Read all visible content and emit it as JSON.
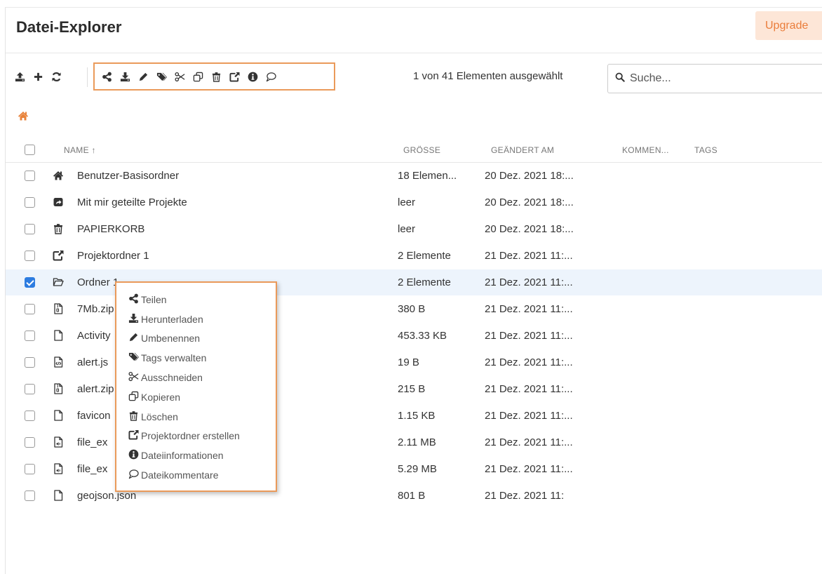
{
  "header": {
    "title": "Datei-Explorer",
    "upgrade_label": "Upgrade"
  },
  "toolbar": {
    "left": [
      {
        "name": "upload-icon"
      },
      {
        "name": "add-icon"
      },
      {
        "name": "refresh-icon"
      }
    ],
    "selection": [
      {
        "name": "share-icon"
      },
      {
        "name": "download-icon"
      },
      {
        "name": "pencil-icon"
      },
      {
        "name": "tags-icon"
      },
      {
        "name": "scissors-icon"
      },
      {
        "name": "copy-icon"
      },
      {
        "name": "trash-icon"
      },
      {
        "name": "share-square-icon"
      },
      {
        "name": "info-icon"
      },
      {
        "name": "comment-icon"
      }
    ],
    "selection_count": "1 von 41 Elementen ausgewählt",
    "search_placeholder": "Suche..."
  },
  "breadcrumb": {
    "icon": "home-icon"
  },
  "table": {
    "columns": {
      "name": "NAME ↑",
      "size": "GRÖSSE",
      "modified": "GEÄNDERT AM",
      "comments": "KOMMEN...",
      "tags": "TAGS"
    },
    "rows": [
      {
        "icon": "home-icon",
        "name": "Benutzer-Basisordner",
        "size": "18 Elemen...",
        "modified": "20 Dez. 2021 18:...",
        "checked": false
      },
      {
        "icon": "shared-folder-icon",
        "name": "Mit mir geteilte Projekte",
        "size": "leer",
        "modified": "20 Dez. 2021 18:...",
        "checked": false
      },
      {
        "icon": "trash-icon",
        "name": "PAPIERKORB",
        "size": "leer",
        "modified": "20 Dez. 2021 18:...",
        "checked": false
      },
      {
        "icon": "share-square-icon",
        "name": "Projektordner 1",
        "size": "2 Elemente",
        "modified": "21 Dez. 2021 11:...",
        "checked": false
      },
      {
        "icon": "folder-open-icon",
        "name": "Ordner 1",
        "size": "2 Elemente",
        "modified": "21 Dez. 2021 11:...",
        "checked": true
      },
      {
        "icon": "zip-file-icon",
        "name": "7Mb.zip",
        "size": "380 B",
        "modified": "21 Dez. 2021 11:...",
        "checked": false
      },
      {
        "icon": "file-icon",
        "name": "Activity",
        "size": "453.33 KB",
        "modified": "21 Dez. 2021 11:...",
        "checked": false
      },
      {
        "icon": "code-file-icon",
        "name": "alert.js",
        "size": "19 B",
        "modified": "21 Dez. 2021 11:...",
        "checked": false
      },
      {
        "icon": "zip-file-icon",
        "name": "alert.zip",
        "size": "215 B",
        "modified": "21 Dez. 2021 11:...",
        "checked": false
      },
      {
        "icon": "file-icon",
        "name": "favicon",
        "size": "1.15 KB",
        "modified": "21 Dez. 2021 11:...",
        "checked": false
      },
      {
        "icon": "audio-file-icon",
        "name": "file_ex",
        "size": "2.11 MB",
        "modified": "21 Dez. 2021 11:...",
        "checked": false
      },
      {
        "icon": "audio-file-icon",
        "name": "file_ex",
        "size": "5.29 MB",
        "modified": "21 Dez. 2021 11:...",
        "checked": false
      },
      {
        "icon": "file-icon",
        "name": "geojson.json",
        "size": "801 B",
        "modified": "21 Dez. 2021 11:",
        "checked": false
      }
    ]
  },
  "context_menu": {
    "items": [
      {
        "icon": "share-icon",
        "label": "Teilen"
      },
      {
        "icon": "download-icon",
        "label": "Herunterladen"
      },
      {
        "icon": "pencil-icon",
        "label": "Umbenennen"
      },
      {
        "icon": "tags-icon",
        "label": "Tags verwalten"
      },
      {
        "icon": "scissors-icon",
        "label": "Ausschneiden"
      },
      {
        "icon": "copy-icon",
        "label": "Kopieren"
      },
      {
        "icon": "trash-icon",
        "label": "Löschen"
      },
      {
        "icon": "share-square-icon",
        "label": "Projektordner erstellen"
      },
      {
        "icon": "info-icon",
        "label": "Dateiinformationen"
      },
      {
        "icon": "comment-icon",
        "label": "Dateikommentare"
      }
    ]
  },
  "colors": {
    "accent": "#ea9a5a",
    "upgrade_bg": "#fde6d7",
    "upgrade_text": "#ea7d3b",
    "home": "#e8823a",
    "checkbox": "#2d7ce0",
    "selected_row": "#edf4fc"
  }
}
